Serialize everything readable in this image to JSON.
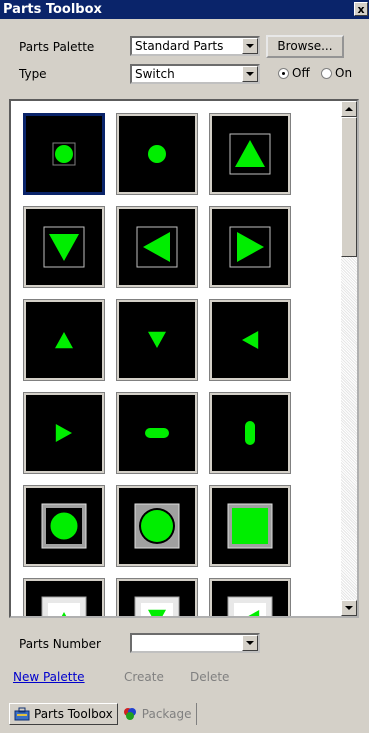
{
  "window": {
    "title": "Parts Toolbox",
    "close": "x"
  },
  "controls": {
    "palette_label": "Parts Palette",
    "palette_value": "Standard Parts",
    "browse_label": "Browse...",
    "type_label": "Type",
    "type_value": "Switch",
    "state_off": "Off",
    "state_on": "On",
    "state_selected": "Off"
  },
  "parts": [
    {
      "shape": "small-square",
      "selected": true
    },
    {
      "shape": "circle"
    },
    {
      "shape": "framed-triangle-up"
    },
    {
      "shape": "framed-triangle-down"
    },
    {
      "shape": "framed-triangle-left"
    },
    {
      "shape": "framed-triangle-right"
    },
    {
      "shape": "triangle-up"
    },
    {
      "shape": "triangle-down"
    },
    {
      "shape": "triangle-left"
    },
    {
      "shape": "triangle-right"
    },
    {
      "shape": "horizontal-pill"
    },
    {
      "shape": "vertical-pill"
    },
    {
      "shape": "bezel-circle"
    },
    {
      "shape": "bezel-circle-large"
    },
    {
      "shape": "bezel-square"
    },
    {
      "shape": "bezel-triangle-up"
    },
    {
      "shape": "bezel-triangle-down"
    },
    {
      "shape": "bezel-triangle-left"
    }
  ],
  "bottom": {
    "parts_number_label": "Parts Number",
    "parts_number_value": "",
    "new_palette": "New Palette",
    "create": "Create",
    "delete": "Delete"
  },
  "tabs": [
    {
      "label": "Parts Toolbox",
      "icon": "toolbox-icon",
      "active": true
    },
    {
      "label": "Package",
      "icon": "package-icon",
      "active": false
    }
  ],
  "colors": {
    "part_green": "#00ee00",
    "part_bg": "#000000",
    "title_bar": "#0a246a"
  }
}
